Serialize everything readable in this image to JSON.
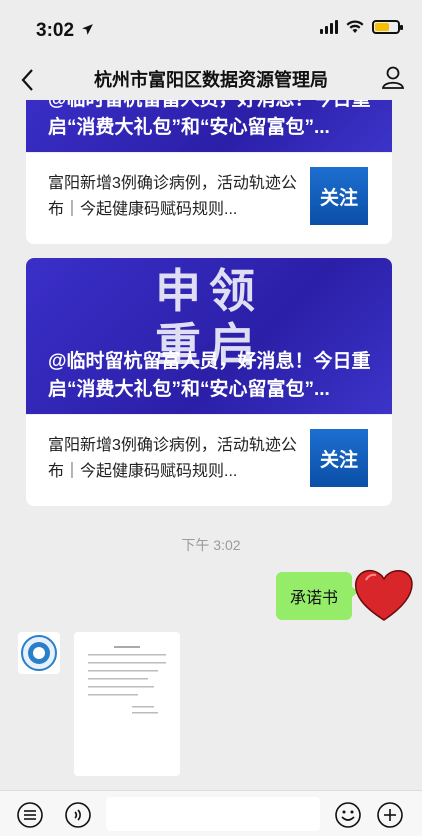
{
  "status_bar": {
    "time": "3:02",
    "location_arrow": "location-arrow-icon"
  },
  "nav": {
    "title": "杭州市富阳区数据资源管理局",
    "back_icon": "chevron-left-icon",
    "profile_icon": "person-icon"
  },
  "articles": [
    {
      "banner_big_text": "",
      "banner_title": "@临时留杭留富人员，好消息！今日重启“消费大礼包”和“安心留富包”...",
      "sub_text": "富阳新增3例确诊病例，活动轨迹公布｜今起健康码赋码规则...",
      "sub_thumb": "关注"
    },
    {
      "banner_big_text": "申领\n重启",
      "banner_title": "@临时留杭留富人员，好消息！今日重启“消费大礼包”和“安心留富包”...",
      "sub_text": "富阳新增3例确诊病例，活动轨迹公布｜今起健康码赋码规则...",
      "sub_thumb": "关注"
    }
  ],
  "chat": {
    "timestamp": "下午 3:02",
    "sent_message": "承诺书"
  },
  "colors": {
    "bubble_green": "#95ec69",
    "banner_blue": "#3a2fc8",
    "background": "#ededed"
  }
}
